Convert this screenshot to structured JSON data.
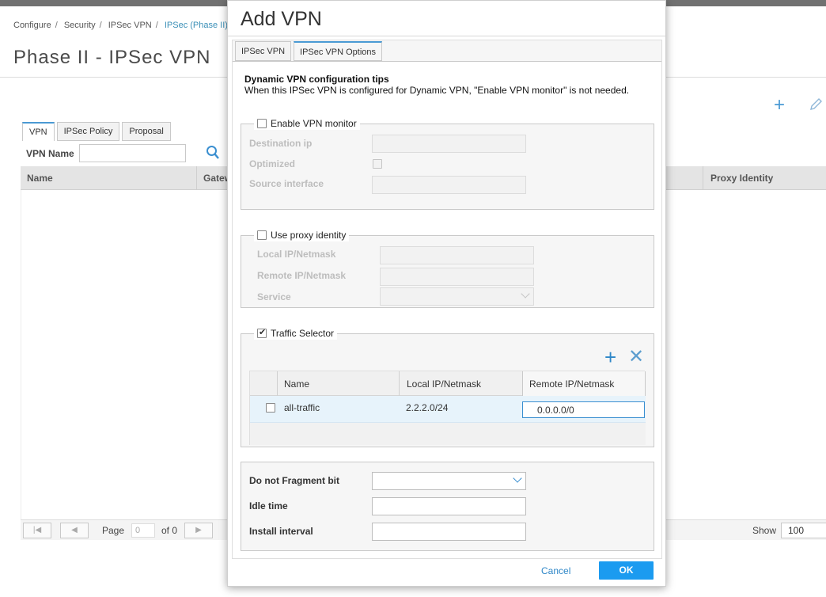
{
  "background": {
    "breadcrumb": [
      "Configure",
      "Security",
      "IPSec VPN",
      "IPSec (Phase II)"
    ],
    "page_title": "Phase II - IPSec VPN",
    "tabs": [
      "VPN",
      "IPSec Policy",
      "Proposal"
    ],
    "search_label": "VPN Name",
    "grid_columns": [
      "Name",
      "Gatew",
      "Proxy Identity"
    ],
    "pager": {
      "page_label": "Page",
      "page_value": "0",
      "of_label": "of 0",
      "show_label": "Show",
      "show_value": "100"
    },
    "icons": [
      "add-icon",
      "edit-icon",
      "search-icon"
    ]
  },
  "modal": {
    "title": "Add VPN",
    "tabs": [
      "IPSec VPN",
      "IPSec VPN Options"
    ],
    "active_tab": "IPSec VPN Options",
    "tips_title": "Dynamic VPN configuration tips",
    "tips_text": "When this IPSec VPN is configured for Dynamic VPN, \"Enable VPN monitor\" is not needed.",
    "vpn_monitor": {
      "legend": "Enable VPN monitor",
      "checked": false,
      "destination_ip_label": "Destination ip",
      "destination_ip_value": "",
      "optimized_label": "Optimized",
      "optimized_checked": false,
      "source_interface_label": "Source interface",
      "source_interface_value": ""
    },
    "proxy_identity": {
      "legend": "Use proxy identity",
      "checked": false,
      "local_label": "Local IP/Netmask",
      "local_value": "",
      "remote_label": "Remote IP/Netmask",
      "remote_value": "",
      "service_label": "Service",
      "service_value": ""
    },
    "traffic_selector": {
      "legend": "Traffic Selector",
      "checked": true,
      "columns": [
        "Name",
        "Local IP/Netmask",
        "Remote IP/Netmask"
      ],
      "rows": [
        {
          "checked": false,
          "name": "all-traffic",
          "local": "2.2.2.0/24",
          "remote": "0.0.0.0/0"
        }
      ]
    },
    "advanced": {
      "fragment_label": "Do not Fragment bit",
      "fragment_value": "",
      "idle_label": "Idle time",
      "idle_value": "",
      "install_label": "Install interval",
      "install_value": ""
    },
    "cancel_label": "Cancel",
    "ok_label": "OK"
  },
  "colors": {
    "accent": "#1b9bf0",
    "link": "#2f87c8",
    "row_highlight": "#e7f3fb"
  }
}
